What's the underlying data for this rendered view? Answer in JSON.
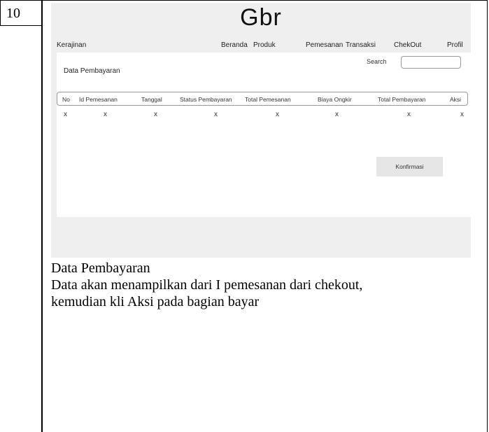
{
  "row_number": "10",
  "mockup": {
    "title": "Gbr",
    "brand": "Kerajinan",
    "nav": [
      "Beranda",
      "Produk",
      "Pemesanan",
      "Transaksi",
      "ChekOut",
      "Profil"
    ],
    "page_title": "Data Pembayaran",
    "search": {
      "label": "Search",
      "value": ""
    },
    "table": {
      "headers": [
        "No",
        "Id Pemesanan",
        "Tanggal",
        "Status Pembayaran",
        "Total Pemesanan",
        "Biaya Ongkir",
        "Total Pembayaran",
        "Aksi"
      ],
      "rows": [
        [
          "x",
          "x",
          "x",
          "x",
          "x",
          "x",
          "x",
          "x"
        ]
      ]
    },
    "confirm_label": "Konfirmasi"
  },
  "description": {
    "heading": "Data Pembayaran",
    "line1": "Data akan menampilkan dari I pemesanan dari chekout,",
    "line2": "kemudian kli Aksi pada bagian bayar"
  }
}
